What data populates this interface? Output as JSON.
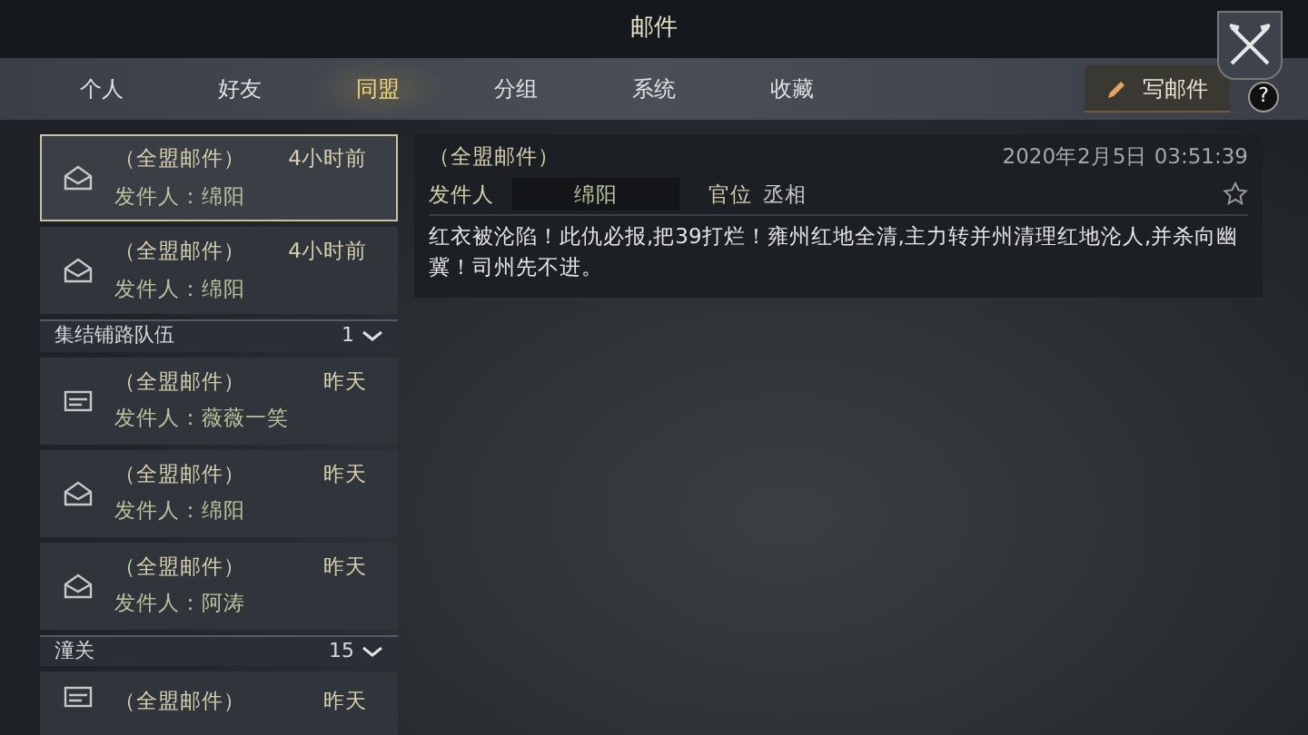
{
  "window": {
    "title": "邮件"
  },
  "tabs": [
    {
      "label": "个人",
      "selected": false
    },
    {
      "label": "好友",
      "selected": false
    },
    {
      "label": "同盟",
      "selected": true
    },
    {
      "label": "分组",
      "selected": false
    },
    {
      "label": "系统",
      "selected": false
    },
    {
      "label": "收藏",
      "selected": false
    }
  ],
  "compose_button": {
    "label": "写邮件"
  },
  "help_button": {
    "label": "?"
  },
  "mail_list": [
    {
      "kind": "envelope",
      "title": "（全盟邮件）",
      "time": "4小时前",
      "sender": "发件人：绵阳",
      "selected": true
    },
    {
      "kind": "envelope",
      "title": "（全盟邮件）",
      "time": "4小时前",
      "sender": "发件人：绵阳",
      "selected": false
    },
    {
      "kind": "group",
      "label": "集结铺路队伍",
      "count": "1"
    },
    {
      "kind": "card",
      "title": "（全盟邮件）",
      "time": "昨天",
      "sender": "发件人：薇薇一笑",
      "selected": false
    },
    {
      "kind": "envelope",
      "title": "（全盟邮件）",
      "time": "昨天",
      "sender": "发件人：绵阳",
      "selected": false
    },
    {
      "kind": "envelope",
      "title": "（全盟邮件）",
      "time": "昨天",
      "sender": "发件人：阿涛",
      "selected": false
    },
    {
      "kind": "group",
      "label": "潼关",
      "count": "15"
    },
    {
      "kind": "card",
      "title": "（全盟邮件）",
      "time": "昨天",
      "selected": false
    }
  ],
  "message": {
    "title": "（全盟邮件）",
    "date": "2020年2月5日 03:51:39",
    "sender_label": "发件人",
    "sender": "绵阳",
    "rank_label": "官位",
    "rank": "丞相",
    "starred": false,
    "body": "红衣被沦陷！此仇必报,把39打烂！雍州红地全清,主力转并州清理红地沦人,并杀向幽冀！司州先不进。"
  }
}
